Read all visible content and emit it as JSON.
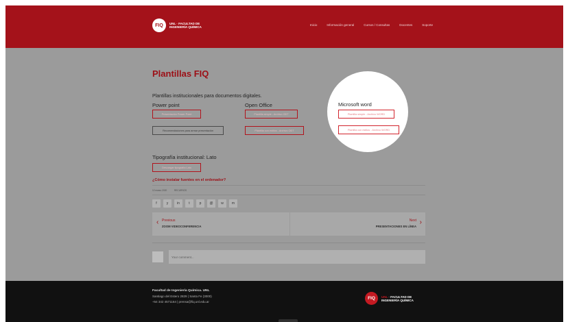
{
  "header": {
    "logo_mark": "FIQ",
    "logo_line1": "UNL · FACULTAD DE",
    "logo_line2": "INGENIERÍA QUÍMICA",
    "nav": [
      "Inicio",
      "Información general",
      "Cursos / Consultas",
      "Docentes",
      "Soporte"
    ]
  },
  "page": {
    "title": "Plantillas FIQ",
    "description": "Plantillas institucionales para documentos digitales."
  },
  "sections": {
    "powerpoint": {
      "label": "Power point",
      "buttons": [
        "Presentación Power Point",
        "Recomendaciones para armar presentación"
      ]
    },
    "openoffice": {
      "label": "Open Office",
      "buttons": [
        "Plantilla simple - Archivo ODT",
        "Plantilla con estilos - Archivo ODT"
      ]
    },
    "word": {
      "label": "Microsoft word",
      "buttons": [
        "Plantilla simple - Archivo WORD",
        "Plantilla con estilos - Archivo WORD"
      ]
    },
    "font": {
      "label": "Tipografía institucional: Lato",
      "button": "Descargar tipografía Lato",
      "link": "¿Cómo instalar fuentes en el ordenador?"
    }
  },
  "meta": {
    "date": "12 marzo 2020",
    "category": "RECURSOS"
  },
  "share_icons": [
    "f",
    "y",
    "in",
    "t",
    "p",
    "@",
    "w",
    "m"
  ],
  "post_nav": {
    "prev_label": "Previous",
    "prev_title": "ZOOM VIDEOCONFERENCIA",
    "next_label": "Next",
    "next_title": "PRESENTACIONES EN LÍNEA"
  },
  "comment": {
    "placeholder": "Your comment..."
  },
  "footer": {
    "name": "Facultad de Ingeniería Química. UNL",
    "address": "Santiago del Estero 2829 | Santa Fe (3000)",
    "contact": "+54 342 4571164 | prensa@fiq.unl.edu.ar",
    "logo_mark": "FIQ",
    "logo_line1_accent": "UNL",
    "logo_line1": "· FACULTAD DE",
    "logo_line2": "INGENIERÍA QUÍMICA"
  }
}
